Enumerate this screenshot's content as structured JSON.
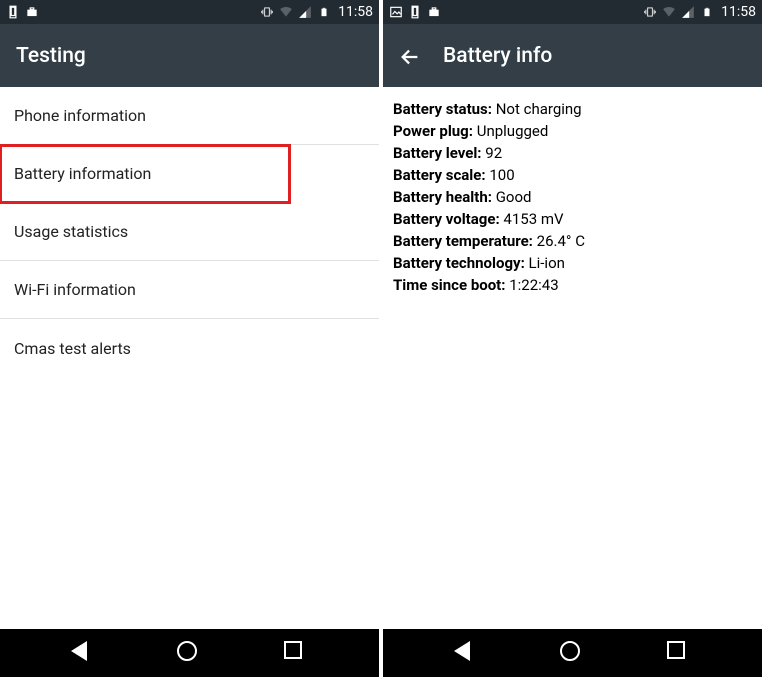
{
  "status": {
    "time": "11:58"
  },
  "left_screen": {
    "title": "Testing",
    "items": [
      {
        "label": "Phone information",
        "highlighted": false
      },
      {
        "label": "Battery information",
        "highlighted": true
      },
      {
        "label": "Usage statistics",
        "highlighted": false
      },
      {
        "label": "Wi-Fi information",
        "highlighted": false
      },
      {
        "label": "Cmas test alerts",
        "highlighted": false
      }
    ]
  },
  "right_screen": {
    "title": "Battery info",
    "info": [
      {
        "label": "Battery status:",
        "value": "Not charging"
      },
      {
        "label": "Power plug:",
        "value": "Unplugged"
      },
      {
        "label": "Battery level:",
        "value": "92"
      },
      {
        "label": "Battery scale:",
        "value": "100"
      },
      {
        "label": "Battery health:",
        "value": "Good"
      },
      {
        "label": "Battery voltage:",
        "value": "4153 mV"
      },
      {
        "label": "Battery temperature:",
        "value": " 26.4° C"
      },
      {
        "label": "Battery technology:",
        "value": "Li-ion"
      },
      {
        "label": "Time since boot:",
        "value": "1:22:43"
      }
    ]
  }
}
